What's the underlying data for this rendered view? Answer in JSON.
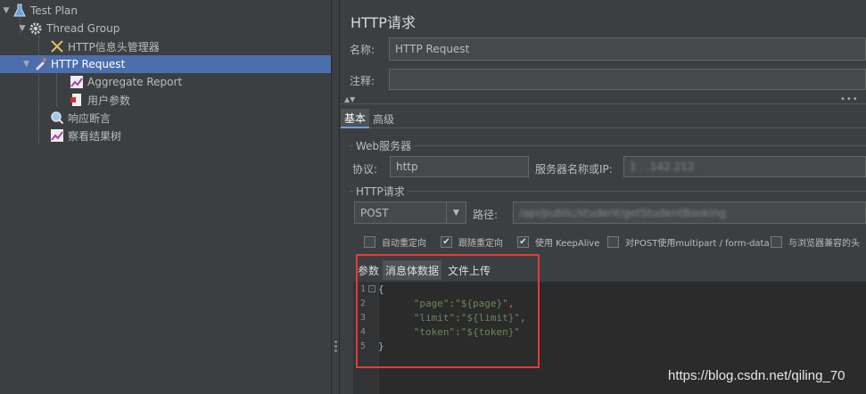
{
  "tree": {
    "items": [
      {
        "label": "Test Plan"
      },
      {
        "label": "Thread Group"
      },
      {
        "label": "HTTP信息头管理器"
      },
      {
        "label": "HTTP Request"
      },
      {
        "label": "Aggregate Report"
      },
      {
        "label": "用户参数"
      },
      {
        "label": "响应断言"
      },
      {
        "label": "察看结果树"
      }
    ]
  },
  "panel": {
    "title": "HTTP请求",
    "name_label": "名称:",
    "name_value": "HTTP Request",
    "comment_label": "注释:",
    "comment_value": "",
    "tabs": [
      {
        "label": "基本"
      },
      {
        "label": "高级"
      }
    ],
    "web_server_group": "Web服务器",
    "protocol_label": "协议:",
    "protocol_value": "http",
    "server_label": "服务器名称或IP:",
    "server_value": "1 .   .142.212",
    "http_request_group": "HTTP请求",
    "method_value": "POST",
    "path_label": "路径:",
    "path_value": "/api/public/student/getStudentBooking",
    "checkboxes": [
      {
        "label": "自动重定向",
        "checked": false
      },
      {
        "label": "跟随重定向",
        "checked": true
      },
      {
        "label": "使用 KeepAlive",
        "checked": true
      },
      {
        "label": "对POST使用multipart / form-data",
        "checked": false
      },
      {
        "label": "与浏览器兼容的头",
        "checked": false
      }
    ],
    "subtabs": [
      {
        "label": "参数"
      },
      {
        "label": "消息体数据"
      },
      {
        "label": "文件上传"
      }
    ],
    "code_lines": [
      {
        "num": "1",
        "brace": "{"
      },
      {
        "num": "2",
        "key": "\"page\"",
        "colon": ":",
        "value": "\"${page}\"",
        "comma": ","
      },
      {
        "num": "3",
        "key": "\"limit\"",
        "colon": ":",
        "value": "\"${limit}\"",
        "comma": ","
      },
      {
        "num": "4",
        "key": "\"token\"",
        "colon": ":",
        "value": "\"${token}\"",
        "comma": ""
      },
      {
        "num": "5",
        "brace": "}"
      }
    ]
  },
  "watermark": "https://blog.csdn.net/qiling_70",
  "colors": {
    "selection": "#4b6eaf",
    "highlight_box": "#e03c3c",
    "string": "#6a8759"
  }
}
